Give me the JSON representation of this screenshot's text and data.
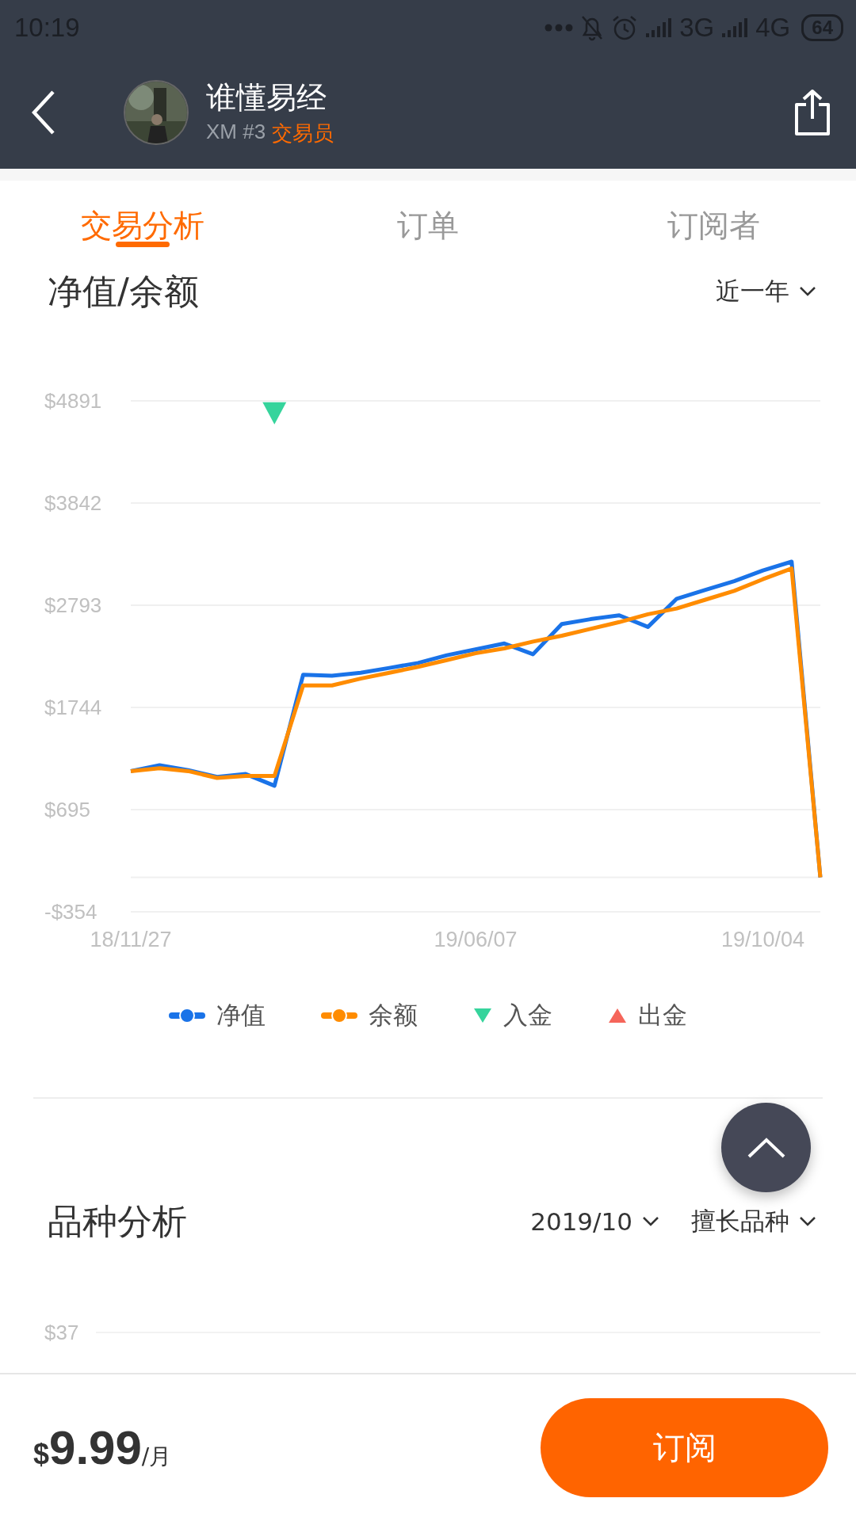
{
  "status_bar": {
    "time": "10:19",
    "network_1": "3G",
    "network_2": "4G",
    "battery": "64"
  },
  "header": {
    "title": "谁懂易经",
    "broker": "XM #3",
    "role": "交易员"
  },
  "tabs": [
    {
      "label": "交易分析",
      "selected": true
    },
    {
      "label": "订单",
      "selected": false
    },
    {
      "label": "订阅者",
      "selected": false
    }
  ],
  "equity_section": {
    "title": "净值/余额",
    "range": "近一年",
    "chart_data": {
      "type": "line",
      "grid": true,
      "categories": [
        "18/11/27",
        null,
        null,
        null,
        null,
        null,
        null,
        null,
        null,
        null,
        null,
        null,
        "19/06/07",
        null,
        null,
        null,
        null,
        null,
        null,
        null,
        null,
        null,
        "19/10/04",
        null,
        null
      ],
      "series": [
        {
          "name": "净值",
          "color": "#1a73e8",
          "values": [
            1090,
            1150,
            1100,
            1030,
            1060,
            940,
            2080,
            2070,
            2100,
            2150,
            2200,
            2280,
            2340,
            2400,
            2290,
            2600,
            2650,
            2690,
            2570,
            2860,
            2950,
            3040,
            3150,
            3240,
            0
          ]
        },
        {
          "name": "余额",
          "color": "#ff8c00",
          "values": [
            1090,
            1120,
            1090,
            1020,
            1040,
            1040,
            1970,
            1970,
            2040,
            2100,
            2160,
            2230,
            2300,
            2350,
            2420,
            2480,
            2550,
            2620,
            2700,
            2760,
            2850,
            2940,
            3060,
            3170,
            0
          ]
        },
        {
          "name": "入金",
          "type": "scatter",
          "color": "#36d49c",
          "values": [
            null,
            null,
            null,
            null,
            null,
            4780,
            null,
            null,
            null,
            null,
            null,
            null,
            null,
            null,
            null,
            null,
            null,
            null,
            null,
            null,
            null,
            null,
            null,
            null,
            null
          ]
        },
        {
          "name": "出金",
          "type": "scatter",
          "color": "#f5655a",
          "values": [
            null,
            null,
            null,
            null,
            null,
            null,
            null,
            null,
            null,
            null,
            null,
            null,
            null,
            null,
            null,
            null,
            null,
            null,
            null,
            null,
            null,
            null,
            null,
            null,
            null
          ]
        }
      ],
      "ylim": [
        -354,
        4891
      ],
      "yticks": [
        {
          "value": 4891,
          "label": "$4891"
        },
        {
          "value": 3842,
          "label": "$3842"
        },
        {
          "value": 2793,
          "label": "$2793"
        },
        {
          "value": 1744,
          "label": "$1744"
        },
        {
          "value": 695,
          "label": "$695"
        },
        {
          "value": -354,
          "label": "-$354"
        }
      ]
    }
  },
  "symbol_section": {
    "title": "品种分析",
    "filters": [
      "2019/10",
      "擅长品种"
    ],
    "ytick_label": "$37"
  },
  "footer": {
    "currency": "$",
    "price": "9.99",
    "unit": "/月",
    "subscribe": "订阅"
  }
}
